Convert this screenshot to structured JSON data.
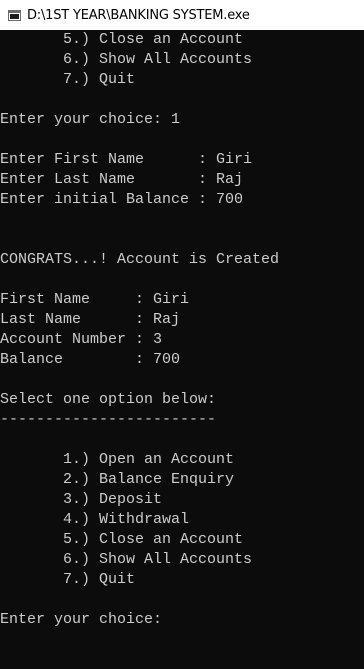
{
  "window": {
    "title": "D:\\1ST YEAR\\BANKING SYSTEM.exe"
  },
  "console": {
    "lines": [
      "       5.) Close an Account",
      "       6.) Show All Accounts",
      "       7.) Quit",
      "",
      "Enter your choice: 1",
      "",
      "Enter First Name      : Giri",
      "Enter Last Name       : Raj",
      "Enter initial Balance : 700",
      "",
      "",
      "CONGRATS...! Account is Created",
      "",
      "First Name     : Giri",
      "Last Name      : Raj",
      "Account Number : 3",
      "Balance        : 700",
      "",
      "Select one option below:",
      "------------------------",
      "",
      "       1.) Open an Account",
      "       2.) Balance Enquiry",
      "       3.) Deposit",
      "       4.) Withdrawal",
      "       5.) Close an Account",
      "       6.) Show All Accounts",
      "       7.) Quit",
      "",
      "Enter your choice:"
    ]
  }
}
